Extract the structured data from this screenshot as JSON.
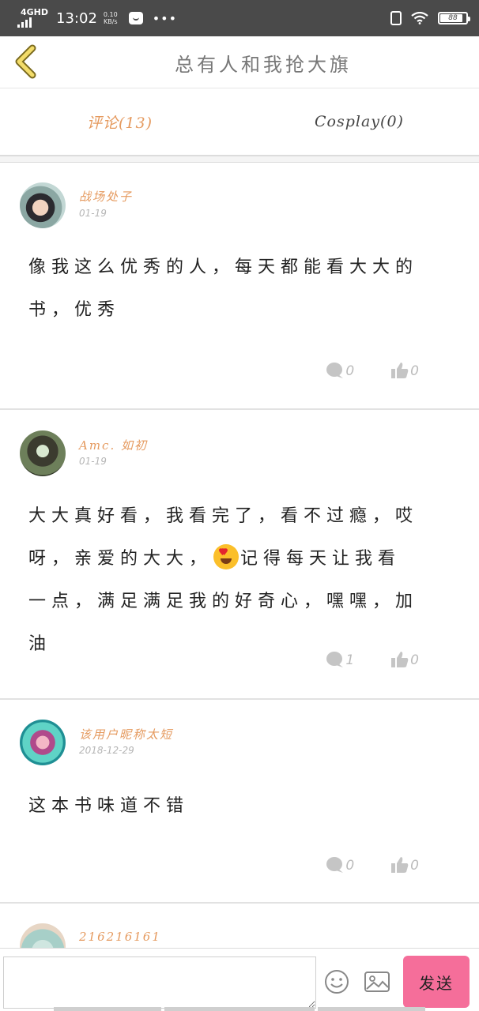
{
  "status_bar": {
    "network": "4GHD",
    "time": "13:02",
    "speed_value": "0.10",
    "speed_unit": "KB/s",
    "battery": "88",
    "icons": [
      "signal-icon",
      "wechat-icon",
      "more-dots-icon",
      "vibrate-icon",
      "wifi-icon",
      "battery-icon"
    ]
  },
  "header": {
    "title": "总有人和我抢大旗",
    "back_icon": "chevron-left-icon",
    "accent_color": "#e59a5f"
  },
  "tabs": [
    {
      "label": "评论(13)",
      "active": true
    },
    {
      "label": "Cosplay(0)",
      "active": false
    }
  ],
  "comments": [
    {
      "user": "战场处子",
      "date": "01-19",
      "text": "像我这么优秀的人，每天都能看大大的书，优秀",
      "replies": "0",
      "likes": "0"
    },
    {
      "user": "Amc. 如初",
      "date": "01-19",
      "text_before_emoji": "大大真好看，我看完了，看不过瘾，哎呀，亲爱的大大，",
      "emoji": "heart-eyes-emoji",
      "text_after_emoji": "记得每天让我看一点，满足满足我的好奇心，嘿嘿，加油",
      "replies": "1",
      "likes": "0"
    },
    {
      "user": "该用户昵称太短",
      "date": "2018-12-29",
      "text": "这本书味道不错",
      "replies": "0",
      "likes": "0"
    },
    {
      "user": "216216161",
      "date": "",
      "text": "",
      "replies": "",
      "likes": ""
    }
  ],
  "bottom_bar": {
    "input_placeholder": "",
    "send_label": "发送",
    "send_color": "#f56e9a",
    "icons": [
      "smiley-icon",
      "image-icon"
    ]
  }
}
